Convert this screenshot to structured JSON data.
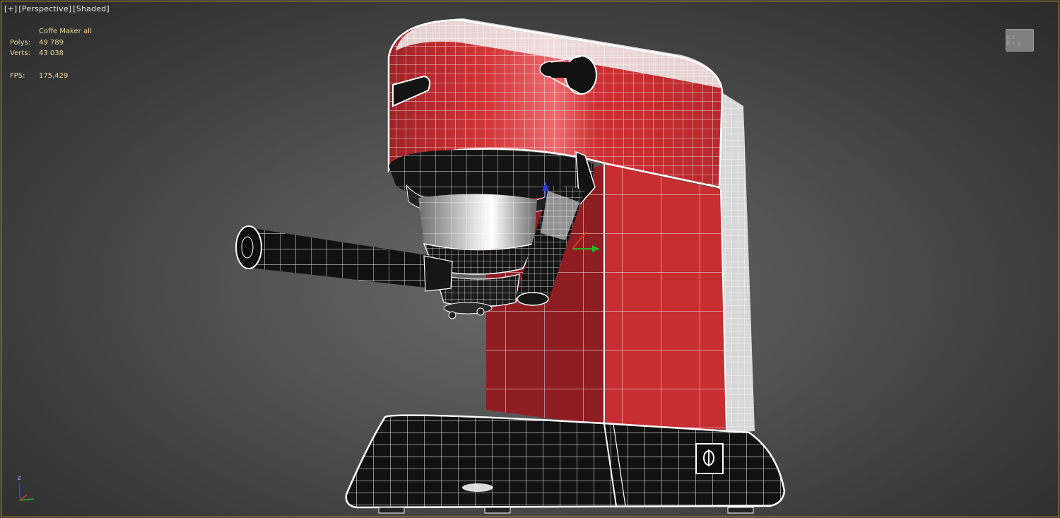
{
  "viewport": {
    "menu": [
      "[+]",
      "[Perspective]",
      "[Shaded]"
    ],
    "stats": {
      "object_name": "Coffe Maker all",
      "polys_label": "Polys:",
      "polys_value": "49 789",
      "verts_label": "Verts:",
      "verts_value": "43 038",
      "fps_label": "FPS:",
      "fps_value": "175,429"
    },
    "viewcube_label": "ot Rig",
    "axis_label": "z"
  },
  "colors": {
    "body_red": "#c62e32",
    "body_red_dark": "#8e1e22",
    "wire": "#ffffff",
    "dark_part": "#1a1a1a",
    "viewport_border": "#c8a22a",
    "stats_text": "#e9d99a"
  }
}
